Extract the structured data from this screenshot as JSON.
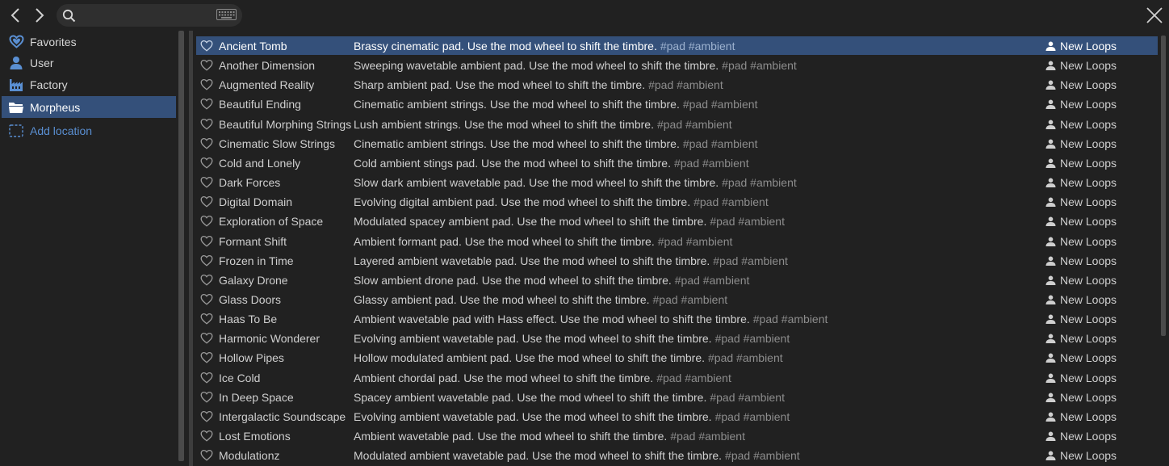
{
  "colors": {
    "background": "#212121",
    "selection": "#34507a",
    "accent": "#5a8fd2",
    "tag_text": "#8d8d8d"
  },
  "toolbar": {
    "back_icon": "chevron-left-icon",
    "forward_icon": "chevron-right-icon",
    "search_placeholder": "",
    "search_value": "",
    "keyboard_icon": "keyboard-icon",
    "close_icon": "close-icon"
  },
  "sidebar": {
    "items": [
      {
        "label": "Favorites",
        "icon": "heart-icon",
        "selected": false
      },
      {
        "label": "User",
        "icon": "user-icon",
        "selected": false
      },
      {
        "label": "Factory",
        "icon": "factory-icon",
        "selected": false
      },
      {
        "label": "Morpheus",
        "icon": "folder-icon",
        "selected": true
      },
      {
        "label": "Add location",
        "icon": "add-location-icon",
        "selected": false
      }
    ]
  },
  "presets": [
    {
      "name": "Ancient Tomb",
      "desc": "Brassy cinematic pad. Use the mod wheel to shift the timbre.",
      "tags": "#pad #ambient",
      "author": "New Loops",
      "selected": true
    },
    {
      "name": "Another Dimension",
      "desc": "Sweeping wavetable ambient pad. Use the mod wheel to shift the timbre.",
      "tags": "#pad #ambient",
      "author": "New Loops"
    },
    {
      "name": "Augmented Reality",
      "desc": "Sharp ambient pad. Use the mod wheel to shift the timbre.",
      "tags": "#pad #ambient",
      "author": "New Loops"
    },
    {
      "name": "Beautiful Ending",
      "desc": "Cinematic ambient strings. Use the mod wheel to shift the timbre.",
      "tags": "#pad #ambient",
      "author": "New Loops"
    },
    {
      "name": "Beautiful Morphing Strings",
      "desc": "Lush ambient strings. Use the mod wheel to shift the timbre.",
      "tags": "#pad #ambient",
      "author": "New Loops"
    },
    {
      "name": "Cinematic Slow Strings",
      "desc": "Cinematic ambient strings. Use the mod wheel to shift the timbre.",
      "tags": "#pad #ambient",
      "author": "New Loops"
    },
    {
      "name": "Cold and Lonely",
      "desc": "Cold ambient stings pad. Use the mod wheel to shift the timbre.",
      "tags": "#pad #ambient",
      "author": "New Loops"
    },
    {
      "name": "Dark Forces",
      "desc": "Slow dark ambient wavetable pad. Use the mod wheel to shift the timbre.",
      "tags": "#pad #ambient",
      "author": "New Loops"
    },
    {
      "name": "Digital Domain",
      "desc": "Evolving digital ambient pad. Use the mod wheel to shift the timbre.",
      "tags": "#pad #ambient",
      "author": "New Loops"
    },
    {
      "name": "Exploration of Space",
      "desc": "Modulated spacey ambient pad. Use the mod wheel to shift the timbre.",
      "tags": "#pad #ambient",
      "author": "New Loops"
    },
    {
      "name": "Formant Shift",
      "desc": "Ambient formant pad. Use the mod wheel to shift the timbre.",
      "tags": "#pad #ambient",
      "author": "New Loops"
    },
    {
      "name": "Frozen in Time",
      "desc": "Layered ambient wavetable pad. Use the mod wheel to shift the timbre.",
      "tags": "#pad #ambient",
      "author": "New Loops"
    },
    {
      "name": "Galaxy Drone",
      "desc": "Slow ambient drone pad. Use the mod wheel to shift the timbre.",
      "tags": "#pad #ambient",
      "author": "New Loops"
    },
    {
      "name": "Glass Doors",
      "desc": "Glassy ambient pad. Use the mod wheel to shift the timbre.",
      "tags": "#pad #ambient",
      "author": "New Loops"
    },
    {
      "name": "Haas To Be",
      "desc": "Ambient wavetable pad with Hass effect. Use the mod wheel to shift the timbre.",
      "tags": "#pad #ambient",
      "author": "New Loops"
    },
    {
      "name": "Harmonic Wonderer",
      "desc": "Evolving ambient wavetable pad. Use the mod wheel to shift the timbre.",
      "tags": "#pad #ambient",
      "author": "New Loops"
    },
    {
      "name": "Hollow Pipes",
      "desc": "Hollow modulated ambient pad. Use the mod wheel to shift the timbre.",
      "tags": "#pad #ambient",
      "author": "New Loops"
    },
    {
      "name": "Ice Cold",
      "desc": "Ambient chordal pad. Use the mod wheel to shift the timbre.",
      "tags": "#pad #ambient",
      "author": "New Loops"
    },
    {
      "name": "In Deep Space",
      "desc": "Spacey ambient wavetable pad. Use the mod wheel to shift the timbre.",
      "tags": "#pad #ambient",
      "author": "New Loops"
    },
    {
      "name": "Intergalactic Soundscape",
      "desc": "Evolving ambient wavetable pad. Use the mod wheel to shift the timbre.",
      "tags": "#pad #ambient",
      "author": "New Loops"
    },
    {
      "name": "Lost Emotions",
      "desc": "Ambient wavetable pad. Use the mod wheel to shift the timbre.",
      "tags": "#pad #ambient",
      "author": "New Loops"
    },
    {
      "name": "Modulationz",
      "desc": "Modulated ambient wavetable pad. Use the mod wheel to shift the timbre.",
      "tags": "#pad #ambient",
      "author": "New Loops"
    }
  ]
}
